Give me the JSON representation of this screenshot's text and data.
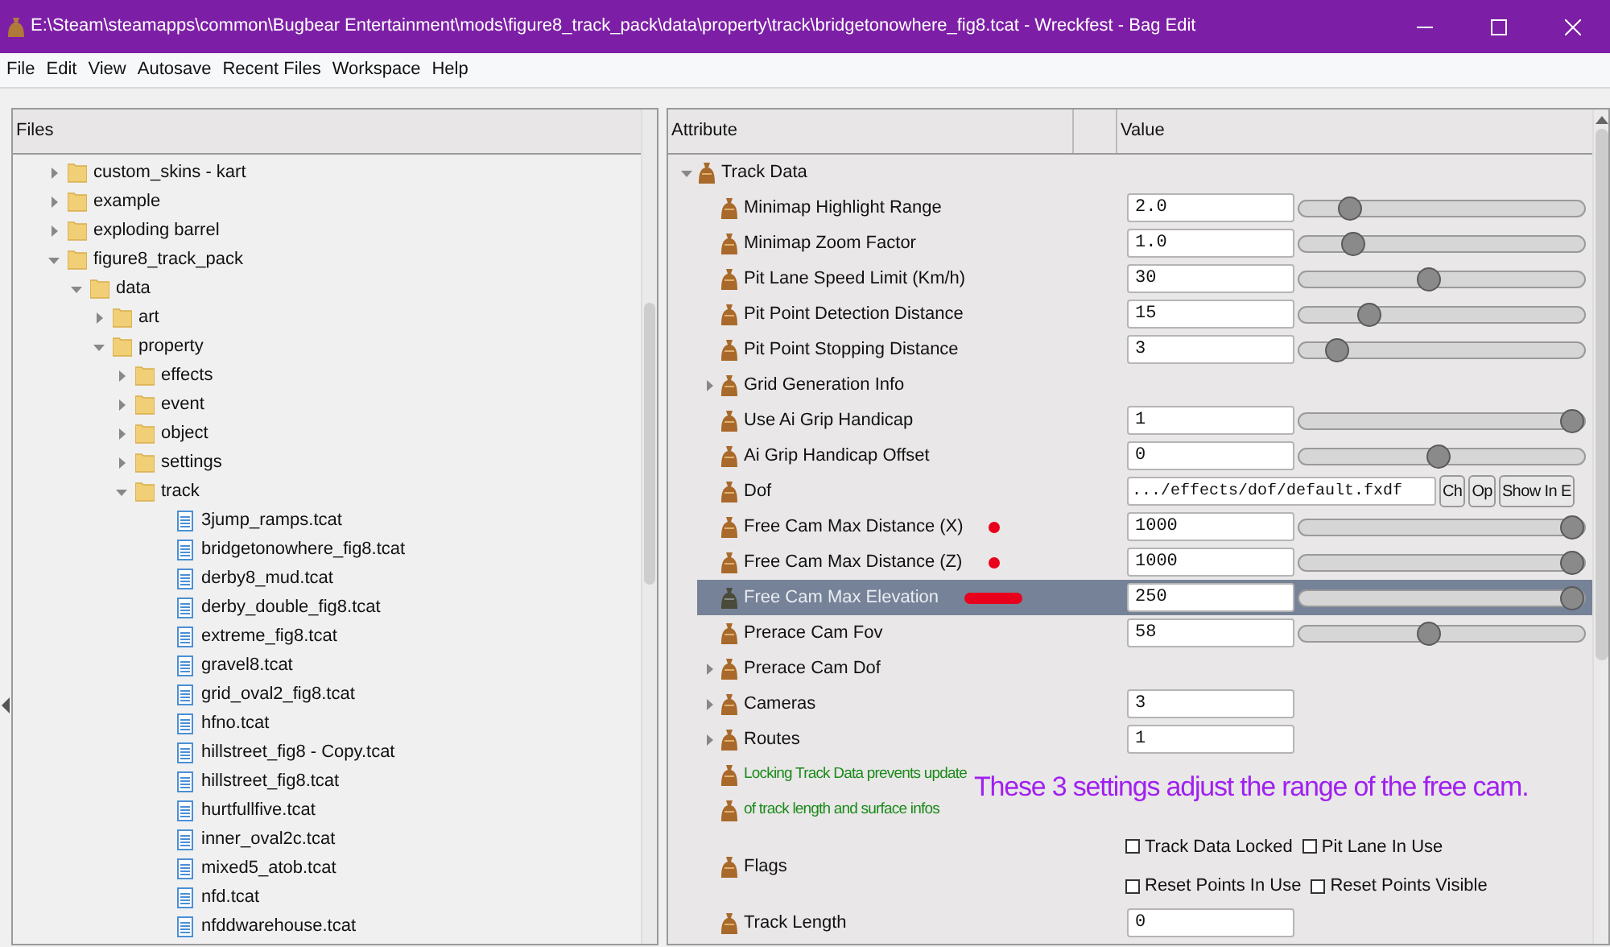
{
  "window": {
    "title": "E:\\Steam\\steamapps\\common\\Bugbear Entertainment\\mods\\figure8_track_pack\\data\\property\\track\\bridgetonowhere_fig8.tcat - Wreckfest - Bag Edit"
  },
  "menu": [
    "File",
    "Edit",
    "View",
    "Autosave",
    "Recent Files",
    "Workspace",
    "Help"
  ],
  "files_panel": {
    "header": "Files",
    "tree": [
      {
        "label": "custom_skins - kart",
        "kind": "folder",
        "expanded": false
      },
      {
        "label": "example",
        "kind": "folder",
        "expanded": false
      },
      {
        "label": "exploding barrel",
        "kind": "folder",
        "expanded": false
      },
      {
        "label": "figure8_track_pack",
        "kind": "folder",
        "expanded": true,
        "children": [
          {
            "label": "data",
            "kind": "folder",
            "expanded": true,
            "children": [
              {
                "label": "art",
                "kind": "folder",
                "expanded": false
              },
              {
                "label": "property",
                "kind": "folder",
                "expanded": true,
                "children": [
                  {
                    "label": "effects",
                    "kind": "folder",
                    "expanded": false
                  },
                  {
                    "label": "event",
                    "kind": "folder",
                    "expanded": false
                  },
                  {
                    "label": "object",
                    "kind": "folder",
                    "expanded": false
                  },
                  {
                    "label": "settings",
                    "kind": "folder",
                    "expanded": false
                  },
                  {
                    "label": "track",
                    "kind": "folder",
                    "expanded": true,
                    "children": [
                      {
                        "label": "3jump_ramps.tcat",
                        "kind": "file"
                      },
                      {
                        "label": "bridgetonowhere_fig8.tcat",
                        "kind": "file"
                      },
                      {
                        "label": "derby8_mud.tcat",
                        "kind": "file"
                      },
                      {
                        "label": "derby_double_fig8.tcat",
                        "kind": "file"
                      },
                      {
                        "label": "extreme_fig8.tcat",
                        "kind": "file"
                      },
                      {
                        "label": "gravel8.tcat",
                        "kind": "file"
                      },
                      {
                        "label": "grid_oval2_fig8.tcat",
                        "kind": "file"
                      },
                      {
                        "label": "hfno.tcat",
                        "kind": "file"
                      },
                      {
                        "label": "hillstreet_fig8 - Copy.tcat",
                        "kind": "file"
                      },
                      {
                        "label": "hillstreet_fig8.tcat",
                        "kind": "file"
                      },
                      {
                        "label": "hurtfullfive.tcat",
                        "kind": "file"
                      },
                      {
                        "label": "inner_oval2c.tcat",
                        "kind": "file"
                      },
                      {
                        "label": "mixed5_atob.tcat",
                        "kind": "file"
                      },
                      {
                        "label": "nfd.tcat",
                        "kind": "file"
                      },
                      {
                        "label": "nfddwarehouse.tcat",
                        "kind": "file"
                      }
                    ]
                  }
                ]
              }
            ]
          }
        ]
      }
    ]
  },
  "attributes_panel": {
    "columns": [
      "Attribute",
      "Value"
    ],
    "rows": [
      {
        "label": "Track Data",
        "kind": "group",
        "expanded": true,
        "selected": false,
        "children": [
          {
            "label": "Minimap Highlight Range",
            "kind": "slider",
            "value": "2.0",
            "level": 0.15,
            "selected": false
          },
          {
            "label": "Minimap Zoom Factor",
            "kind": "slider",
            "value": "1.0",
            "level": 0.16,
            "selected": false
          },
          {
            "label": "Pit Lane Speed Limit (Km/h)",
            "kind": "slider",
            "value": "30",
            "level": 0.45,
            "selected": false
          },
          {
            "label": "Pit Point Detection Distance",
            "kind": "slider",
            "value": "15",
            "level": 0.22,
            "selected": false
          },
          {
            "label": "Pit Point Stopping Distance",
            "kind": "slider",
            "value": "3",
            "level": 0.1,
            "selected": false
          },
          {
            "label": "Grid Generation Info",
            "kind": "group",
            "expanded": false,
            "selected": false
          },
          {
            "label": "Use Ai Grip Handicap",
            "kind": "slider",
            "value": "1",
            "level": 1,
            "selected": false
          },
          {
            "label": "Ai Grip Handicap Offset",
            "kind": "slider",
            "value": "0",
            "level": 0.49,
            "selected": false
          },
          {
            "label": "Dof",
            "kind": "file",
            "value": ".../effects/dof/default.fxdf",
            "buttons": [
              "Ch",
              "Op",
              "Show In E"
            ],
            "selected": false
          },
          {
            "label": "Free Cam Max Distance (X)",
            "kind": "slider",
            "value": "1000",
            "level": 1,
            "selected": false,
            "annotation_mark": {
              "kind": "dot"
            }
          },
          {
            "label": "Free Cam Max Distance (Z)",
            "kind": "slider",
            "value": "1000",
            "level": 1,
            "selected": false,
            "annotation_mark": {
              "kind": "dot"
            }
          },
          {
            "label": "Free Cam Max Elevation",
            "kind": "slider",
            "value": "250",
            "level": 1,
            "selected": true,
            "annotation_mark": {
              "kind": "bar"
            }
          },
          {
            "label": "Prerace Cam Fov",
            "kind": "slider",
            "value": "58",
            "level": 0.45,
            "selected": false
          },
          {
            "label": "Prerace Cam Dof",
            "kind": "group",
            "expanded": false,
            "selected": false
          },
          {
            "label": "Cameras",
            "kind": "count",
            "expanded": false,
            "value": "3",
            "selected": false
          },
          {
            "label": "Routes",
            "kind": "count",
            "expanded": false,
            "value": "1",
            "selected": false
          },
          {
            "label": "Locking Track Data prevents update",
            "kind": "note",
            "selected": false
          },
          {
            "label": "of track length and surface infos",
            "kind": "note",
            "selected": false
          },
          {
            "label": "Flags",
            "kind": "flags",
            "selected": false,
            "flags": [
              {
                "label": "Track Data Locked",
                "checked": false
              },
              {
                "label": "Pit Lane In Use",
                "checked": false
              },
              {
                "label": "Reset Points In Use",
                "checked": false
              },
              {
                "label": "Reset Points Visible",
                "checked": false
              }
            ]
          },
          {
            "label": "Track Length",
            "kind": "text",
            "value": "0",
            "selected": false
          }
        ]
      }
    ]
  },
  "annotation": "These 3 settings adjust the range of the free cam."
}
